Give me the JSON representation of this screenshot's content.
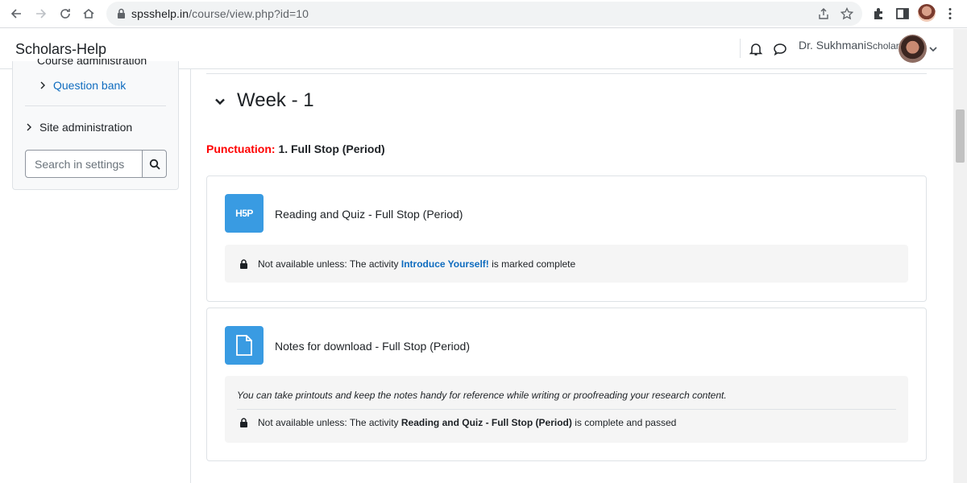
{
  "browser": {
    "url_host": "spsshelp.in",
    "url_path": "/course/view.php?id=10"
  },
  "navbar": {
    "brand": "Scholars-Help",
    "user_name": "Dr. Sukhmani",
    "user_role": "Scholar"
  },
  "drawer": {
    "course_admin_label": "Course administration",
    "question_bank_label": "Question bank",
    "site_admin_label": "Site administration",
    "search_placeholder": "Search in settings"
  },
  "section": {
    "title": "Week - 1",
    "label_red": "Punctuation:",
    "label_rest": "1. Full Stop (Period)"
  },
  "activities": [
    {
      "name": "Reading and Quiz - Full Stop (Period)",
      "icon": "H5P",
      "restriction_prefix": "Not available unless: The activity",
      "restriction_link": "Introduce Yourself!",
      "restriction_suffix": "is marked complete"
    },
    {
      "name": "Notes for download - Full Stop (Period)",
      "icon": "file-icon",
      "description": "You can take printouts and keep the notes handy for reference while writing or proofreading your research content.",
      "restriction_prefix": "Not available unless: The activity",
      "restriction_bold": "Reading and Quiz - Full Stop (Period)",
      "restriction_suffix": "is complete and passed"
    }
  ],
  "colors": {
    "link": "#0f6cbf",
    "activity_icon_bg": "#399be2",
    "section_label_red": "#ff0000"
  }
}
